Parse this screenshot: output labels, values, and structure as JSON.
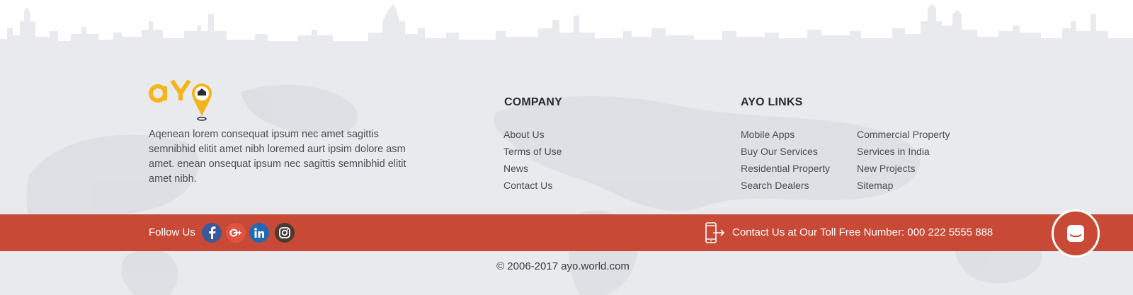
{
  "about": {
    "logo_alt": "ayo",
    "description": "Aqenean lorem consequat ipsum nec amet sagittis semnibhid elitit amet nibh loremed aurt ipsim dolore asm amet. enean onsequat ipsum nec sagittis semnibhid elitit amet nibh."
  },
  "company": {
    "title": "COMPANY",
    "links": [
      "About Us",
      "Terms of Use",
      "News",
      "Contact Us"
    ]
  },
  "ayo_links": {
    "title": "AYO LINKS",
    "col1": [
      "Mobile Apps",
      "Buy Our Services",
      "Residential Property",
      "Search Dealers"
    ],
    "col2": [
      "Commercial Property",
      "Services in India",
      "New Projects",
      "Sitemap"
    ]
  },
  "bar": {
    "follow_label": "Follow Us",
    "social": [
      {
        "icon": "facebook-icon",
        "glyph": "f"
      },
      {
        "icon": "google-plus-icon",
        "glyph": "G+"
      },
      {
        "icon": "linkedin-icon",
        "glyph": "in"
      },
      {
        "icon": "instagram-icon",
        "glyph": ""
      }
    ],
    "contact_text": "Contact Us at Our Toll Free Number: 000 222 5555 888"
  },
  "copyright": "© 2006-2017 ayo.world.com",
  "colors": {
    "accent": "#c84935",
    "background": "#e9eaed",
    "logo_yellow": "#f4b41a"
  }
}
